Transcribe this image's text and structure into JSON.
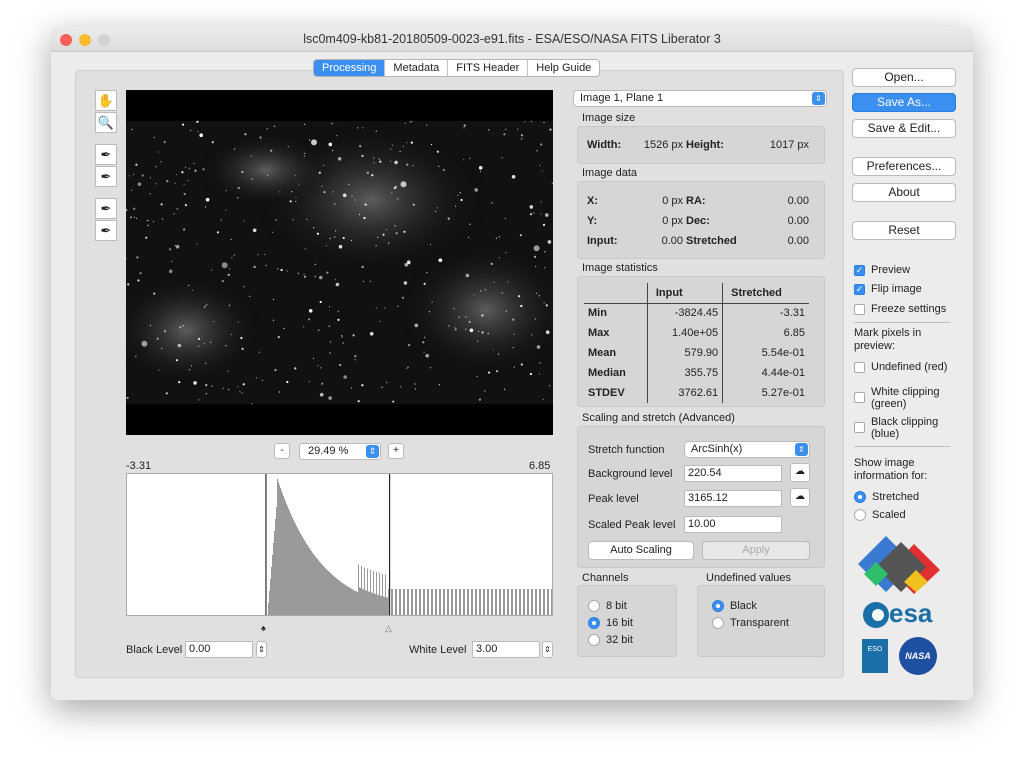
{
  "window": {
    "title": "lsc0m409-kb81-20180509-0023-e91.fits - ESA/ESO/NASA FITS Liberator 3"
  },
  "tabs": [
    "Processing",
    "Metadata",
    "FITS Header",
    "Help Guide"
  ],
  "image_select": "Image 1, Plane 1",
  "image_size": {
    "header": "Image size",
    "width_label": "Width:",
    "width": "1526 px",
    "height_label": "Height:",
    "height": "1017 px"
  },
  "image_data": {
    "header": "Image data",
    "x_label": "X:",
    "x": "0 px",
    "ra_label": "RA:",
    "ra": "0.00",
    "y_label": "Y:",
    "y": "0 px",
    "dec_label": "Dec:",
    "dec": "0.00",
    "input_label": "Input:",
    "input": "0.00",
    "stretched_label": "Stretched",
    "stretched": "0.00"
  },
  "stats": {
    "header": "Image statistics",
    "col_input": "Input",
    "col_stretched": "Stretched",
    "rows": [
      {
        "label": "Min",
        "input": "-3824.45",
        "stretched": "-3.31"
      },
      {
        "label": "Max",
        "input": "1.40e+05",
        "stretched": "6.85"
      },
      {
        "label": "Mean",
        "input": "579.90",
        "stretched": "5.54e-01"
      },
      {
        "label": "Median",
        "input": "355.75",
        "stretched": "4.44e-01"
      },
      {
        "label": "STDEV",
        "input": "3762.61",
        "stretched": "5.27e-01"
      }
    ]
  },
  "scaling": {
    "header": "Scaling and stretch (Advanced)",
    "stretch_label": "Stretch function",
    "stretch_value": "ArcSinh(x)",
    "bg_label": "Background level",
    "bg_value": "220.54",
    "peak_label": "Peak level",
    "peak_value": "3165.12",
    "scaled_label": "Scaled Peak level",
    "scaled_value": "10.00",
    "auto_label": "Auto Scaling",
    "apply_label": "Apply"
  },
  "channels": {
    "header": "Channels",
    "options": [
      "8 bit",
      "16 bit",
      "32 bit"
    ],
    "selected": "16 bit"
  },
  "undefined": {
    "header": "Undefined values",
    "options": [
      "Black",
      "Transparent"
    ],
    "selected": "Black"
  },
  "zoom": {
    "minus": "-",
    "value": "29.49 %",
    "plus": "+"
  },
  "histogram": {
    "min_label": "-3.31",
    "max_label": "6.85",
    "black_marker_pos": 0.327,
    "white_marker_pos": 0.618
  },
  "levels": {
    "black_label": "Black Level",
    "black_value": "0.00",
    "white_label": "White Level",
    "white_value": "3.00"
  },
  "buttons": {
    "open": "Open...",
    "save_as": "Save As...",
    "save_edit": "Save & Edit...",
    "preferences": "Preferences...",
    "about": "About",
    "reset": "Reset"
  },
  "options": {
    "preview": "Preview",
    "flip": "Flip image",
    "freeze": "Freeze settings",
    "mark_header": "Mark pixels in preview:",
    "undefined_red": "Undefined (red)",
    "white_clip": "White clipping (green)",
    "black_clip": "Black clipping (blue)",
    "show_header": "Show image information for:",
    "stretched": "Stretched",
    "scaled": "Scaled"
  },
  "logos": {
    "esa": "esa",
    "eso": "ESO",
    "nasa": "NASA"
  },
  "colors": {
    "accent": "#3b8ff0",
    "window_bg": "#ececec"
  }
}
